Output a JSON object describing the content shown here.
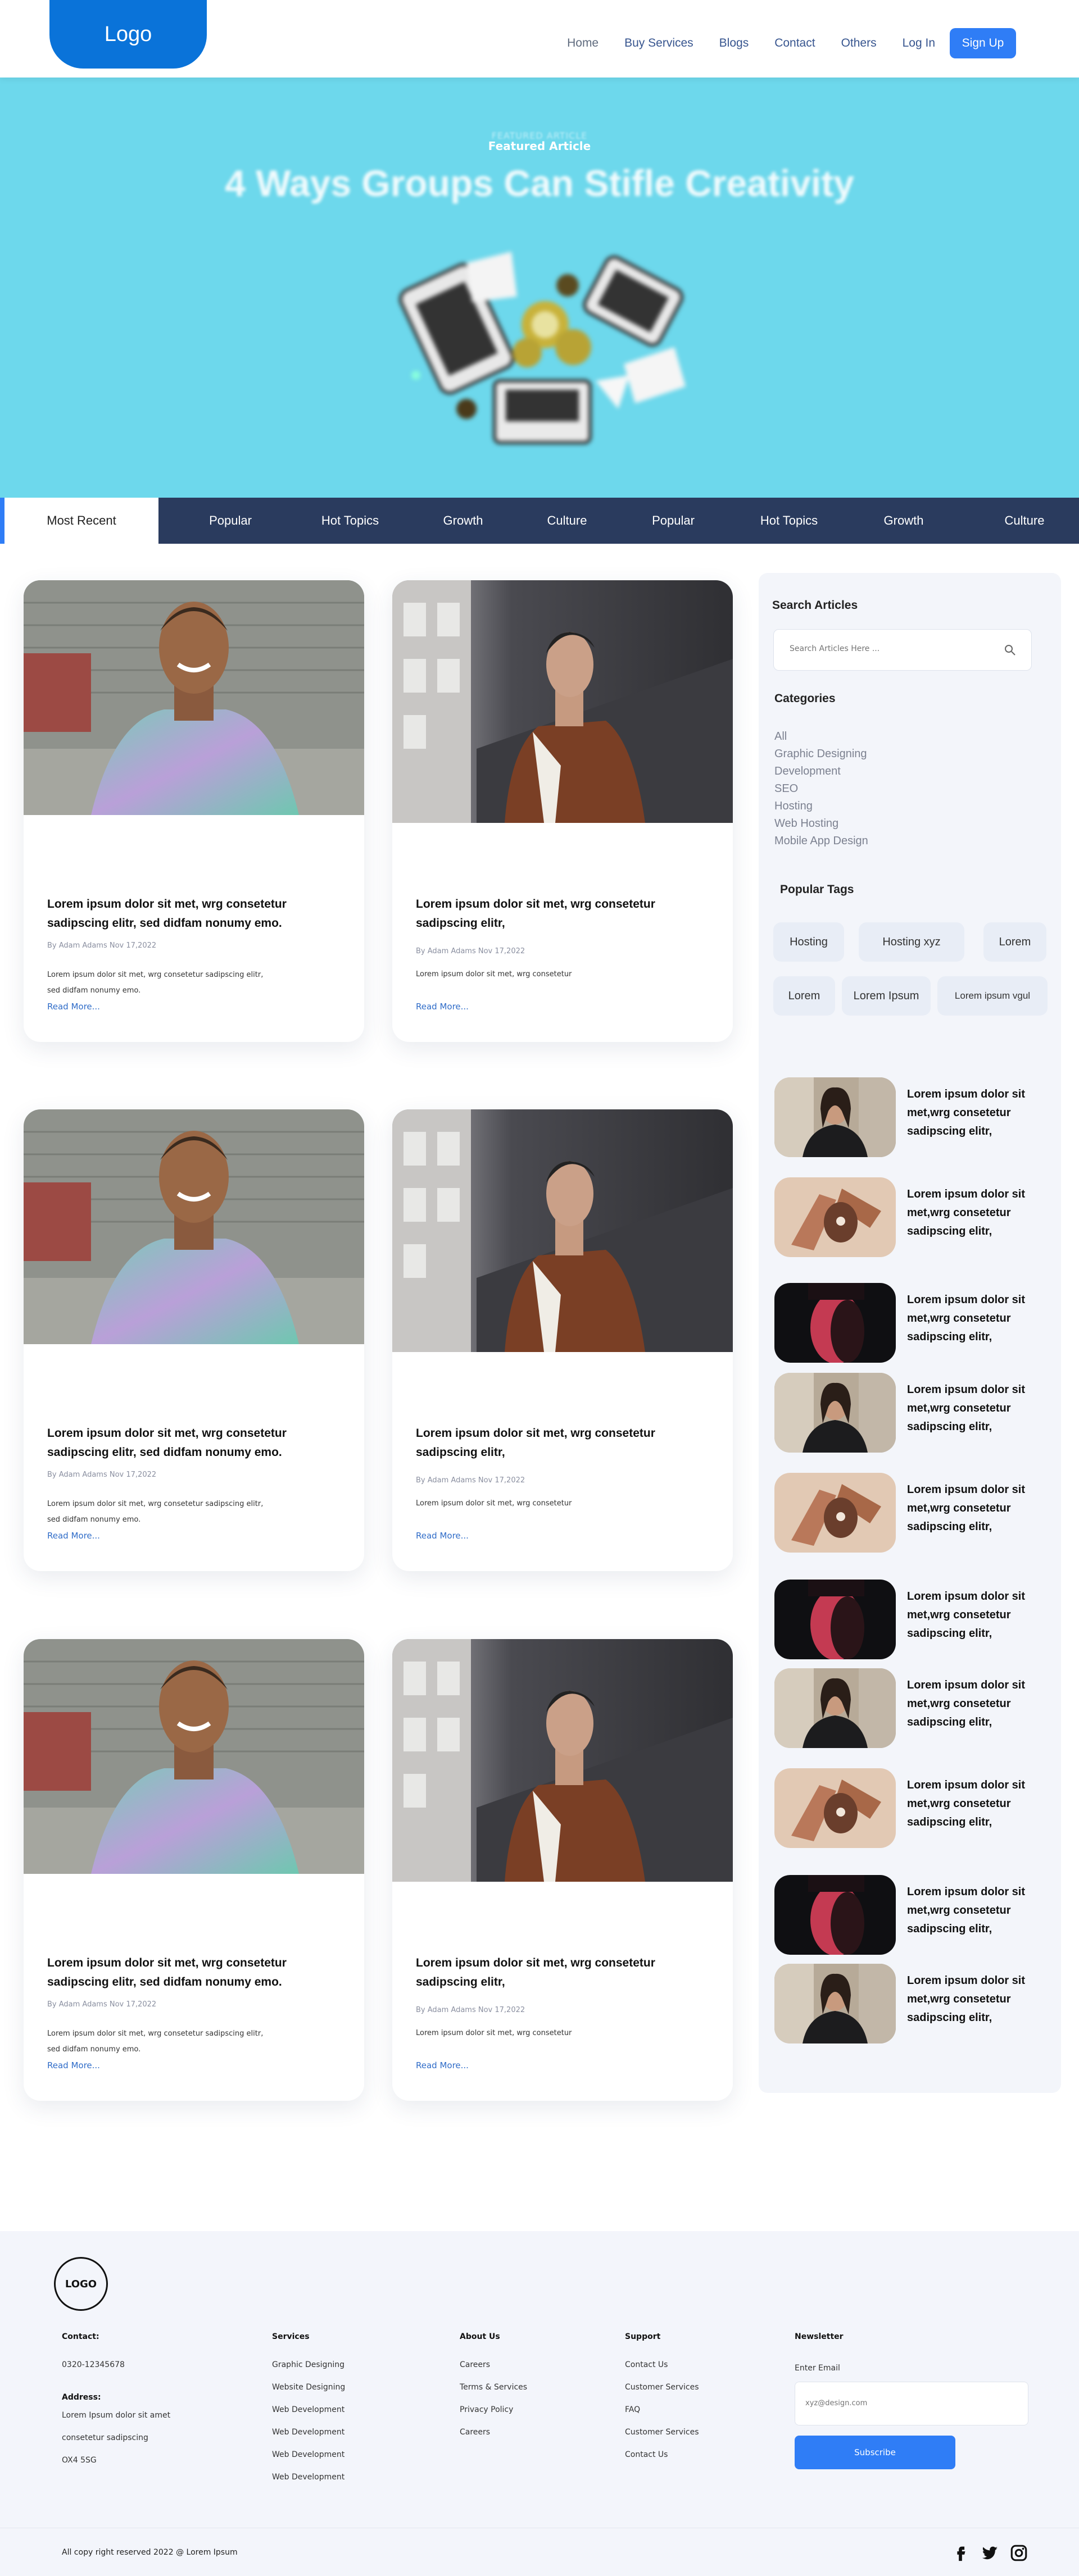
{
  "header": {
    "logo": "Logo",
    "nav": [
      "Home",
      "Buy Services",
      "Blogs",
      "Contact",
      "Others",
      "Log In"
    ],
    "signup": "Sign Up"
  },
  "hero": {
    "kicker_ghost": "FEATURED ARTICLE",
    "kicker": "Featured Article",
    "title": "4 Ways Groups Can Stifle Creativity"
  },
  "tabs": [
    "Most Recent",
    "Popular",
    "Hot Topics",
    "Growth",
    "Culture",
    "Popular",
    "Hot Topics",
    "Growth",
    "Culture"
  ],
  "cards": [
    {
      "title": "Lorem ipsum dolor sit met, wrg consetetur sadipscing elitr, sed didfam nonumy emo.",
      "meta": "By Adam Adams Nov 17,2022",
      "excerpt": "Lorem ipsum dolor sit met, wrg consetetur sadipscing elitr, sed didfam nonumy emo.",
      "more": "Read More..."
    },
    {
      "title": "Lorem ipsum dolor sit met, wrg consetetur sadipscing elitr,",
      "meta": "By Adam Adams Nov 17,2022",
      "excerpt": "Lorem ipsum dolor sit met, wrg consetetur",
      "more": "Read More..."
    },
    {
      "title": "Lorem ipsum dolor sit met, wrg consetetur sadipscing elitr, sed didfam nonumy emo.",
      "meta": "By Adam Adams Nov 17,2022",
      "excerpt": "Lorem ipsum dolor sit met, wrg consetetur sadipscing elitr, sed didfam nonumy emo.",
      "more": "Read More..."
    },
    {
      "title": "Lorem ipsum dolor sit met, wrg consetetur sadipscing elitr,",
      "meta": "By Adam Adams Nov 17,2022",
      "excerpt": "Lorem ipsum dolor sit met, wrg consetetur",
      "more": "Read More..."
    },
    {
      "title": "Lorem ipsum dolor sit met, wrg consetetur sadipscing elitr, sed didfam nonumy emo.",
      "meta": "By Adam Adams Nov 17,2022",
      "excerpt": "Lorem ipsum dolor sit met, wrg consetetur sadipscing elitr, sed didfam nonumy emo.",
      "more": "Read More..."
    },
    {
      "title": "Lorem ipsum dolor sit met, wrg consetetur sadipscing elitr,",
      "meta": "By Adam Adams Nov 17,2022",
      "excerpt": "Lorem ipsum dolor sit met, wrg consetetur",
      "more": "Read More..."
    }
  ],
  "sidebar": {
    "search_heading": "Search Articles",
    "search_placeholder": "Search Articles Here ...",
    "categories_heading": "Categories",
    "categories": [
      "All",
      "Graphic Designing",
      "Development",
      "SEO",
      "Hosting",
      "Web Hosting",
      "Mobile App Design"
    ],
    "tags_heading": "Popular Tags",
    "tags": [
      "Hosting",
      "Hosting xyz",
      "Lorem",
      "Lorem",
      "Lorem Ipsum",
      "Lorem ipsum vgul"
    ],
    "post_title": "Lorem ipsum dolor sit met,wrg consetetur sadipscing elitr,"
  },
  "footer": {
    "logo": "LOGO",
    "contact": {
      "heading": "Contact:",
      "phone": "0320-12345678",
      "address_heading": "Address:",
      "address": [
        "Lorem Ipsum dolor sit amet",
        "consetetur sadipscing",
        "OX4 5SG"
      ]
    },
    "services": {
      "heading": "Services",
      "items": [
        "Graphic Designing",
        "Website Designing",
        "Web Development",
        "Web Development",
        "Web Development",
        "Web Development"
      ]
    },
    "about": {
      "heading": "About Us",
      "items": [
        "Careers",
        "Terms & Services",
        "Privacy Policy",
        "Careers"
      ]
    },
    "support": {
      "heading": "Support",
      "items": [
        "Contact Us",
        "Customer Services",
        "FAQ",
        "Customer Services",
        "Contact Us"
      ]
    },
    "newsletter": {
      "heading": "Newsletter",
      "label": "Enter Email",
      "placeholder": "xyz@design.com",
      "button": "Subscribe"
    },
    "copyright": "All copy right reserved 2022 @ Lorem Ipsum",
    "social": [
      "facebook-icon",
      "twitter-icon",
      "instagram-icon"
    ]
  }
}
